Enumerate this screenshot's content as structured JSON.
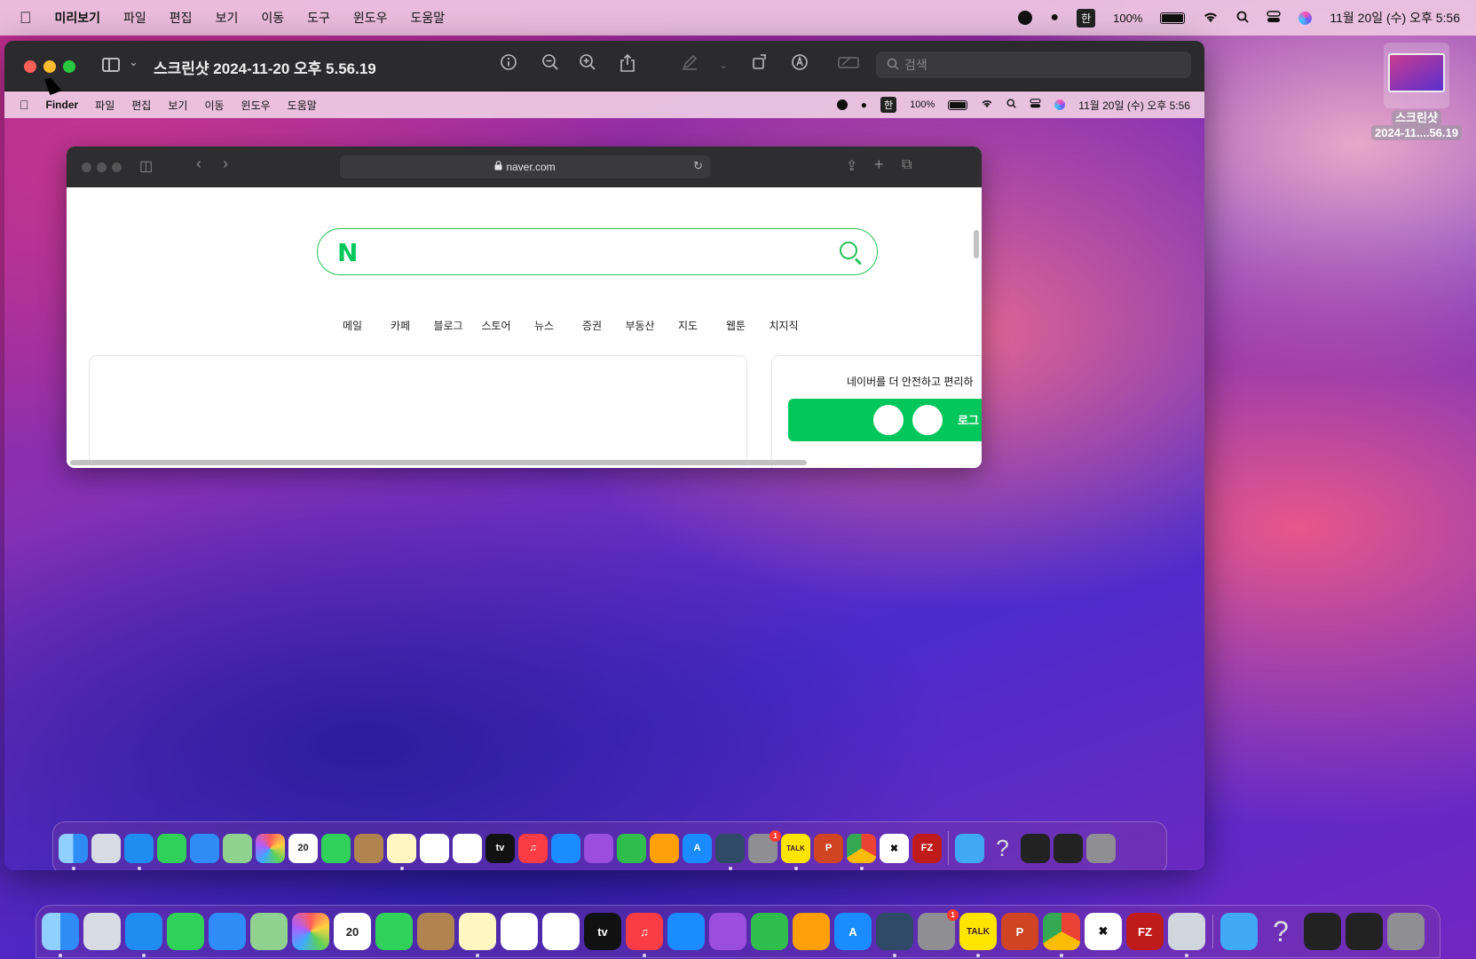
{
  "menubar": {
    "app_name": "미리보기",
    "items": [
      "파일",
      "편집",
      "보기",
      "이동",
      "도구",
      "윈도우",
      "도움말"
    ],
    "input_source": "한",
    "battery": "100%",
    "clock": "11월 20일 (수) 오후 5:56"
  },
  "preview": {
    "title": "스크린샷 2024-11-20 오후 5.56.19",
    "search_placeholder": "검색"
  },
  "inner_menubar": {
    "app_name": "Finder",
    "items": [
      "파일",
      "편집",
      "보기",
      "이동",
      "윈도우",
      "도움말"
    ],
    "input_source": "한",
    "battery": "100%",
    "clock": "11월 20일 (수) 오후 5:56"
  },
  "safari": {
    "url": "naver.com"
  },
  "naver": {
    "logo": "N",
    "nav": [
      "메일",
      "카페",
      "블로그",
      "스토어",
      "뉴스",
      "증권",
      "부동산",
      "지도",
      "웹툰",
      "치지직"
    ],
    "promo_text": "네이버를 더 안전하고 편리하",
    "login_text": "로그"
  },
  "desktop_file": {
    "line1": "스크린샷",
    "line2": "2024-11....56.19"
  },
  "dock_badge": "1"
}
